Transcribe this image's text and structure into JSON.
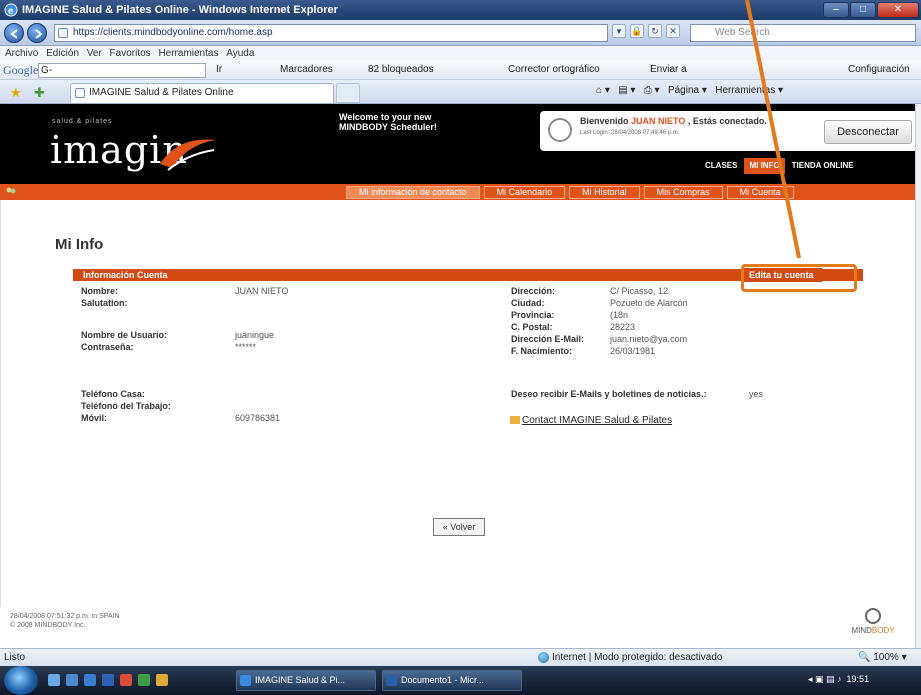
{
  "window": {
    "title": "IMAGINE Salud & Pilates Online - Windows Internet Explorer",
    "min": "–",
    "max": "□",
    "close": "✕"
  },
  "addressbar": {
    "url": "https://clients.mindbodyonline.com/home.asp",
    "search_placeholder": "Web Search"
  },
  "menubar": [
    "Archivo",
    "Edición",
    "Ver",
    "Favoritos",
    "Herramientas",
    "Ayuda"
  ],
  "google_toolbar": {
    "logo": "Google",
    "search_value": "G-",
    "go": "Ir",
    "bookmarks": "Marcadores",
    "blocked": "82 bloqueados",
    "spellcheck": "Corrector ortográfico",
    "send": "Enviar a",
    "settings": "Configuración"
  },
  "tabs": {
    "active_label": "IMAGINE Salud & Pilates Online",
    "page": "Página",
    "tools": "Herramientas"
  },
  "site": {
    "logo_small": "salud & pilates",
    "logo": "imagin",
    "welcome": "Welcome to your new MINDBODY Scheduler!",
    "greeting_prefix": "Bienvenido ",
    "user_name": "JUAN NIETO",
    "greeting_suffix": " , Estás conectado.",
    "last_login": "Last Login: 28/04/2008 07:49:46 p.m.",
    "logout": "Desconectar",
    "topnav": [
      {
        "label": "CLASES",
        "active": false
      },
      {
        "label": "MI INFO",
        "active": true
      },
      {
        "label": "TIENDA ONLINE",
        "active": false
      }
    ],
    "subnav": [
      {
        "label": "Mi información de contacto",
        "active": true
      },
      {
        "label": "Mi Calendario",
        "active": false
      },
      {
        "label": "Mi Historial",
        "active": false
      },
      {
        "label": "Mis Compras",
        "active": false
      },
      {
        "label": "Mi Cuenta",
        "active": false
      }
    ]
  },
  "page": {
    "title": "Mi Info",
    "section_label": "Información Cuenta",
    "edit_button": "Edita tu cuenta",
    "left_fields": {
      "nombre_k": "Nombre:",
      "nombre_v": "JUAN NIETO",
      "salutation_k": "Salutation:",
      "salutation_v": "",
      "usuario_k": "Nombre de Usuario:",
      "usuario_v": "juaningue",
      "password_k": "Contraseña:",
      "password_v": "******",
      "tel_casa_k": "Teléfono Casa:",
      "tel_casa_v": "",
      "tel_trabajo_k": "Teléfono del Trabajo:",
      "tel_trabajo_v": "",
      "movil_k": "Móvil:",
      "movil_v": "609786381"
    },
    "right_fields": {
      "direccion_k": "Dirección:",
      "direccion_v": "C/ Picasso, 12",
      "ciudad_k": "Ciudad:",
      "ciudad_v": "Pozuelo de Alarcón",
      "provincia_k": "Provincia:",
      "provincia_v": "(18n",
      "postal_k": "C. Postal:",
      "postal_v": "28223",
      "email_k": "Dirección E-Mail:",
      "email_v": "juan.nieto@ya.com",
      "nacimiento_k": "F. Nacimiento:",
      "nacimiento_v": "26/03/1981",
      "newsletter_k": "Deseo recibir E-Mails y boletines de noticias.:",
      "newsletter_v": "yes"
    },
    "contact_link": "Contact IMAGINE Salud & Pilates",
    "back_button": "« Volver"
  },
  "footer": {
    "datetime": "28/04/2008 07:51:32 p.m. in SPAIN",
    "copyright": "© 2008 MINDBODY Inc.",
    "mb_logo_a": "MIND",
    "mb_logo_b": "BODY"
  },
  "statusbar": {
    "left": "Listo",
    "zone": "Internet | Modo protegido: desactivado",
    "zoom": "100%"
  },
  "taskbar": {
    "item1": "IMAGINE Salud & Pi...",
    "item2": "Documento1 - Micr...",
    "clock": "19:51"
  },
  "colors": {
    "accent_orange": "#e0531a",
    "callout_orange": "#e37a1c"
  }
}
